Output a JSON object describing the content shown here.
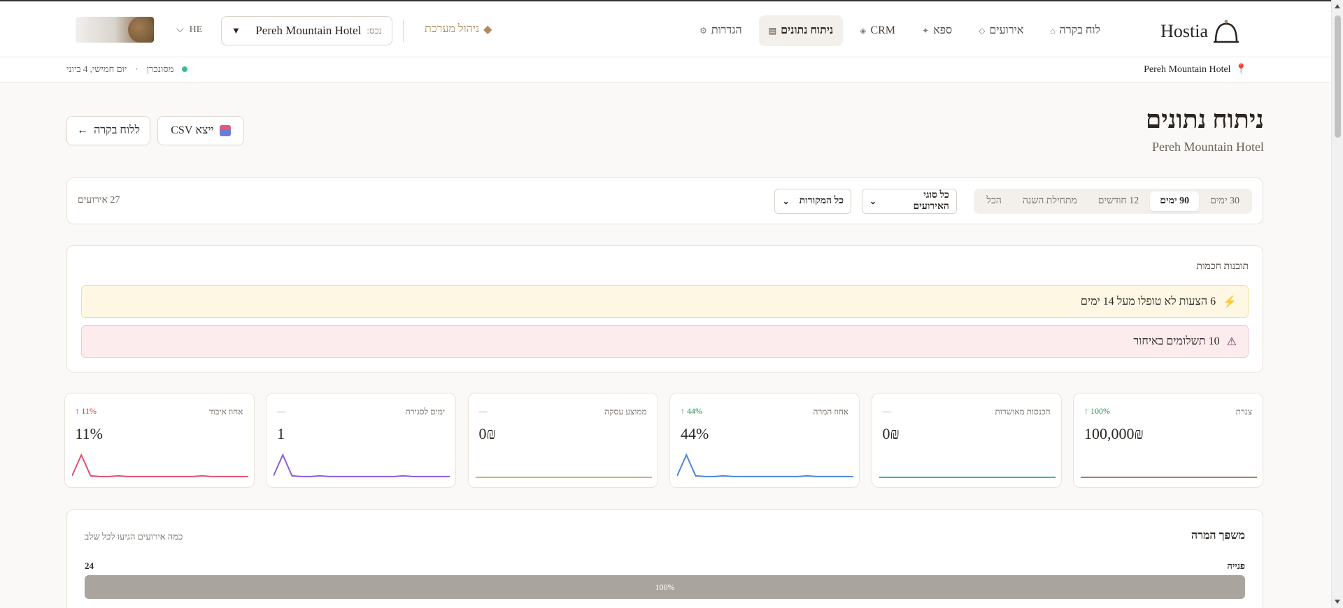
{
  "brand": {
    "name": "Hostia"
  },
  "nav": {
    "items": [
      {
        "label": "לוח בקרה",
        "icon": "⌂",
        "active": false
      },
      {
        "label": "אירועים",
        "icon": "◇",
        "active": false
      },
      {
        "label": "ספא",
        "icon": "✦",
        "active": false
      },
      {
        "label": "CRM",
        "icon": "◈",
        "active": false
      },
      {
        "label": "ניתוח נתונים",
        "icon": "▤",
        "active": true
      },
      {
        "label": "הגדרות",
        "icon": "⚙",
        "active": false
      }
    ],
    "admin_label": "ניהול מערכת",
    "admin_icon": "◆"
  },
  "property_select": {
    "label": "נכס:",
    "value": "Pereh Mountain Hotel",
    "caret": "▼"
  },
  "language": {
    "code": "HE",
    "chevron": "⌵"
  },
  "subbar": {
    "hotel": "Pereh Mountain Hotel",
    "sync_status": "מסונכרן",
    "separator": "·",
    "date": "יום חמישי, 4 ביוני"
  },
  "page": {
    "title": "ניתוח נתונים",
    "subtitle": "Pereh Mountain Hotel",
    "export_label": "ייצא CSV",
    "back_label": "ללוח בקרה",
    "back_arrow": "←"
  },
  "filters": {
    "periods": [
      {
        "label": "30 ימים",
        "active": false
      },
      {
        "label": "90 ימים",
        "active": true
      },
      {
        "label": "12 חודשים",
        "active": false
      },
      {
        "label": "מתחילת השנה",
        "active": false
      },
      {
        "label": "הכל",
        "active": false
      }
    ],
    "event_type": "כל סוגי האירועים",
    "source": "כל המקורות",
    "events_count": "27 אירועים"
  },
  "insights": {
    "title": "תובנות חכמות",
    "alerts": [
      {
        "icon": "lightning-icon",
        "glyph": "⚡",
        "text": "6 הצעות לא טופלו מעל 14 ימים",
        "level": "warning"
      },
      {
        "icon": "warning-icon",
        "glyph": "⚠",
        "text": "10 תשלומים באיחור",
        "level": "danger"
      }
    ]
  },
  "kpis": [
    {
      "title": "צנרת",
      "value": "100,000₪",
      "delta": "↑ 100%",
      "delta_tone": "up-green",
      "color": "#a08560",
      "series": [
        0,
        0,
        0,
        0,
        0,
        0,
        0,
        0,
        0,
        0,
        0,
        0,
        0,
        0,
        0,
        0,
        0,
        0,
        0,
        0
      ]
    },
    {
      "title": "הכנסות מאושרות",
      "value": "0₪",
      "delta": "—",
      "delta_tone": "neutral",
      "color": "#3bbf8c",
      "series": [
        0,
        0,
        0,
        0,
        0,
        0,
        0,
        0,
        0,
        0,
        0,
        0,
        0,
        0,
        0,
        0,
        0,
        0,
        0,
        0
      ]
    },
    {
      "title": "אחוז המרה",
      "value": "44%",
      "delta": "↑ 44%",
      "delta_tone": "up-green",
      "color": "#4a86d8",
      "series": [
        2,
        30,
        2,
        1,
        1,
        2,
        1,
        1,
        1,
        1,
        1,
        1,
        1,
        1,
        2,
        1,
        1,
        1,
        1,
        1
      ]
    },
    {
      "title": "ממוצע עסקה",
      "value": "0₪",
      "delta": "—",
      "delta_tone": "neutral",
      "color": "#d4b06a",
      "series": [
        0,
        0,
        0,
        0,
        0,
        0,
        0,
        0,
        0,
        0,
        0,
        0,
        0,
        0,
        0,
        0,
        0,
        0,
        0,
        0
      ]
    },
    {
      "title": "ימים לסגירה",
      "value": "1",
      "delta": "—",
      "delta_tone": "neutral",
      "color": "#8a5ce0",
      "series": [
        2,
        30,
        2,
        1,
        1,
        2,
        1,
        1,
        1,
        1,
        1,
        1,
        1,
        1,
        2,
        1,
        1,
        1,
        1,
        1
      ]
    },
    {
      "title": "אחוז איבוד",
      "value": "11%",
      "delta": "↑ 11%",
      "delta_tone": "up-red",
      "color": "#e0506e",
      "series": [
        2,
        30,
        2,
        1,
        1,
        2,
        1,
        1,
        1,
        1,
        1,
        1,
        1,
        1,
        2,
        1,
        1,
        1,
        1,
        1
      ]
    }
  ],
  "funnel": {
    "title": "משפך המרה",
    "subtitle": "כמה אירועים הגיעו לכל שלב",
    "stages": [
      {
        "name": "פנייה",
        "count": "24",
        "percent_label": "100%",
        "fraction": 1.0
      }
    ]
  }
}
